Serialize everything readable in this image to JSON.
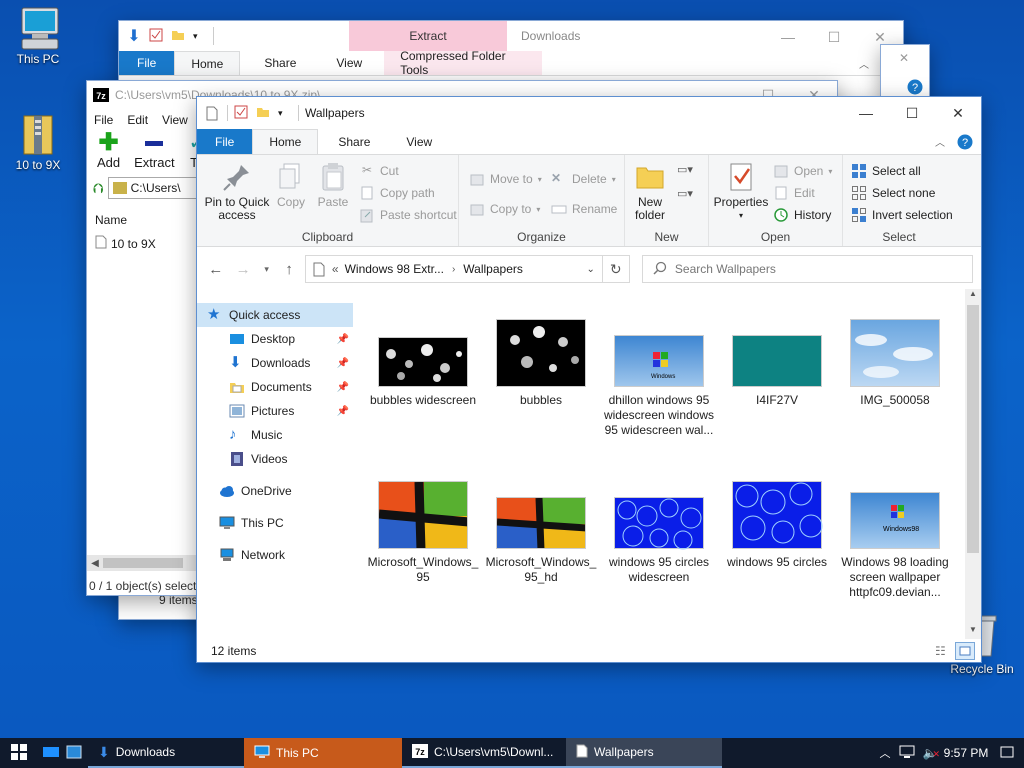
{
  "desktop": {
    "icons": [
      {
        "label": "This PC"
      },
      {
        "label": "10 to 9X"
      },
      {
        "label": "Recycle Bin"
      }
    ]
  },
  "downloads_window": {
    "title": "Downloads",
    "context_tab": "Extract",
    "context_group": "Compressed Folder Tools",
    "tabs": [
      "File",
      "Home",
      "Share",
      "View"
    ],
    "status": "9 items"
  },
  "sevenzip_window": {
    "title": "C:\\Users\\vm5\\Downloads\\10 to 9X.zip\\",
    "menu": [
      "File",
      "Edit",
      "View"
    ],
    "toolbar": [
      "Add",
      "Extract",
      "Te"
    ],
    "path": "C:\\Users\\",
    "column": "Name",
    "file": "10 to 9X",
    "status": "0 / 1 object(s) selected"
  },
  "explorer": {
    "title": "Wallpapers",
    "tabs": [
      "File",
      "Home",
      "Share",
      "View"
    ],
    "ribbon": {
      "clipboard": {
        "label": "Clipboard",
        "pin": "Pin to Quick access",
        "copy": "Copy",
        "paste": "Paste",
        "cut": "Cut",
        "copy_path": "Copy path",
        "paste_shortcut": "Paste shortcut"
      },
      "organize": {
        "label": "Organize",
        "move_to": "Move to",
        "copy_to": "Copy to",
        "delete": "Delete",
        "rename": "Rename"
      },
      "new": {
        "label": "New",
        "new_folder": "New folder"
      },
      "open": {
        "label": "Open",
        "properties": "Properties",
        "open": "Open",
        "edit": "Edit",
        "history": "History"
      },
      "select": {
        "label": "Select",
        "select_all": "Select all",
        "select_none": "Select none",
        "invert": "Invert selection"
      }
    },
    "breadcrumb": [
      "Windows 98 Extr...",
      "Wallpapers"
    ],
    "search_placeholder": "Search Wallpapers",
    "nav": [
      {
        "label": "Quick access",
        "pinned": false
      },
      {
        "label": "Desktop",
        "pinned": true
      },
      {
        "label": "Downloads",
        "pinned": true
      },
      {
        "label": "Documents",
        "pinned": true
      },
      {
        "label": "Pictures",
        "pinned": true
      },
      {
        "label": "Music",
        "pinned": false
      },
      {
        "label": "Videos",
        "pinned": false
      },
      {
        "label": "OneDrive",
        "pinned": false
      },
      {
        "label": "This PC",
        "pinned": false
      },
      {
        "label": "Network",
        "pinned": false
      }
    ],
    "files": [
      {
        "name": "bubbles widescreen"
      },
      {
        "name": "bubbles"
      },
      {
        "name": "dhillon windows 95 widescreen windows 95 widescreen wal..."
      },
      {
        "name": "I4IF27V"
      },
      {
        "name": "IMG_500058"
      },
      {
        "name": "Microsoft_Windows_95"
      },
      {
        "name": "Microsoft_Windows_95_hd"
      },
      {
        "name": "windows 95 circles widescreen"
      },
      {
        "name": "windows 95 circles"
      },
      {
        "name": "Windows 98 loading screen wallpaper httpfc09.devian..."
      }
    ],
    "status": "12 items"
  },
  "taskbar": {
    "items": [
      "Downloads",
      "This PC",
      "C:\\Users\\vm5\\Downl...",
      "Wallpapers"
    ],
    "clock": "9:57 PM"
  }
}
